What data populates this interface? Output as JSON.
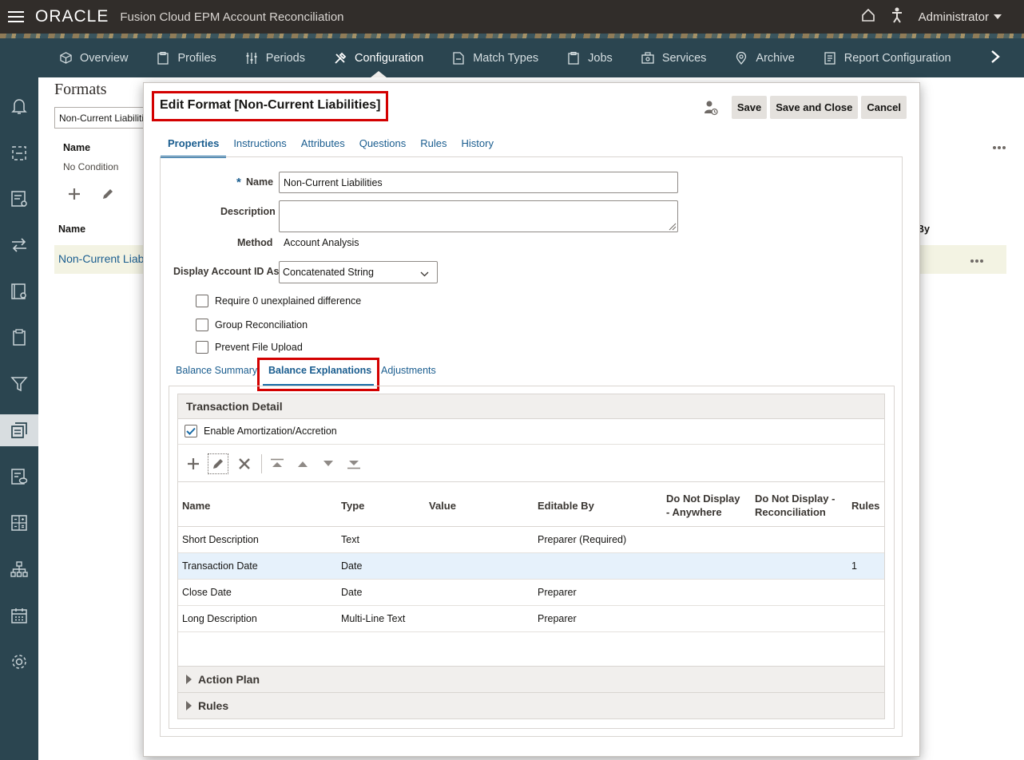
{
  "header": {
    "logo": "ORACLE",
    "app_title": "Fusion Cloud EPM Account Reconciliation",
    "user": "Administrator"
  },
  "nav": {
    "items": [
      {
        "label": "Overview",
        "icon": "cube-icon"
      },
      {
        "label": "Profiles",
        "icon": "clipboard-icon"
      },
      {
        "label": "Periods",
        "icon": "sliders-icon"
      },
      {
        "label": "Configuration",
        "icon": "tools-icon"
      },
      {
        "label": "Match Types",
        "icon": "document-icon"
      },
      {
        "label": "Jobs",
        "icon": "clipboard-icon"
      },
      {
        "label": "Services",
        "icon": "briefcase-icon"
      },
      {
        "label": "Archive",
        "icon": "location-icon"
      },
      {
        "label": "Report Configuration",
        "icon": "report-icon"
      }
    ],
    "active": "Configuration"
  },
  "background": {
    "title": "Formats",
    "search_value": "Non-Current Liabilities",
    "name_header": "Name",
    "condition": "No Condition",
    "list_header": "Name",
    "list_item": "Non-Current Liab",
    "by_header": "By"
  },
  "dialog": {
    "title": "Edit Format [Non-Current Liabilities]",
    "buttons": {
      "save": "Save",
      "save_close": "Save and Close",
      "cancel": "Cancel"
    },
    "tabs": [
      "Properties",
      "Instructions",
      "Attributes",
      "Questions",
      "Rules",
      "History"
    ],
    "active_tab": "Properties",
    "form": {
      "required_mark": "*",
      "name_label": "Name",
      "name_value": "Non-Current Liabilities",
      "description_label": "Description",
      "description_value": "",
      "method_label": "Method",
      "method_value": "Account Analysis",
      "display_label": "Display Account ID As",
      "display_value": "Concatenated String",
      "checkboxes": [
        {
          "label": "Require 0 unexplained difference",
          "checked": false
        },
        {
          "label": "Group Reconciliation",
          "checked": false
        },
        {
          "label": "Prevent File Upload",
          "checked": false
        }
      ]
    },
    "subtabs": [
      "Balance Summary",
      "Balance Explanations",
      "Adjustments"
    ],
    "active_subtab": "Balance Explanations",
    "transaction_detail": {
      "title": "Transaction Detail",
      "enable_label": "Enable Amortization/Accretion",
      "enable_checked": true,
      "columns": {
        "name": "Name",
        "type": "Type",
        "value": "Value",
        "editable_by": "Editable By",
        "dnd_anywhere_1": "Do Not Display",
        "dnd_anywhere_2": "- Anywhere",
        "dnd_recon_1": "Do Not Display -",
        "dnd_recon_2": "Reconciliation",
        "rules": "Rules"
      },
      "rows": [
        {
          "name": "Short Description",
          "type": "Text",
          "value": "",
          "editable_by": "Preparer (Required)",
          "rules": ""
        },
        {
          "name": "Transaction Date",
          "type": "Date",
          "value": "",
          "editable_by": "",
          "rules": "1"
        },
        {
          "name": "Close Date",
          "type": "Date",
          "value": "",
          "editable_by": "Preparer",
          "rules": ""
        },
        {
          "name": "Long Description",
          "type": "Multi-Line Text",
          "value": "",
          "editable_by": "Preparer",
          "rules": ""
        }
      ],
      "selected_row": 1
    },
    "sections": [
      "Action Plan",
      "Rules"
    ]
  }
}
